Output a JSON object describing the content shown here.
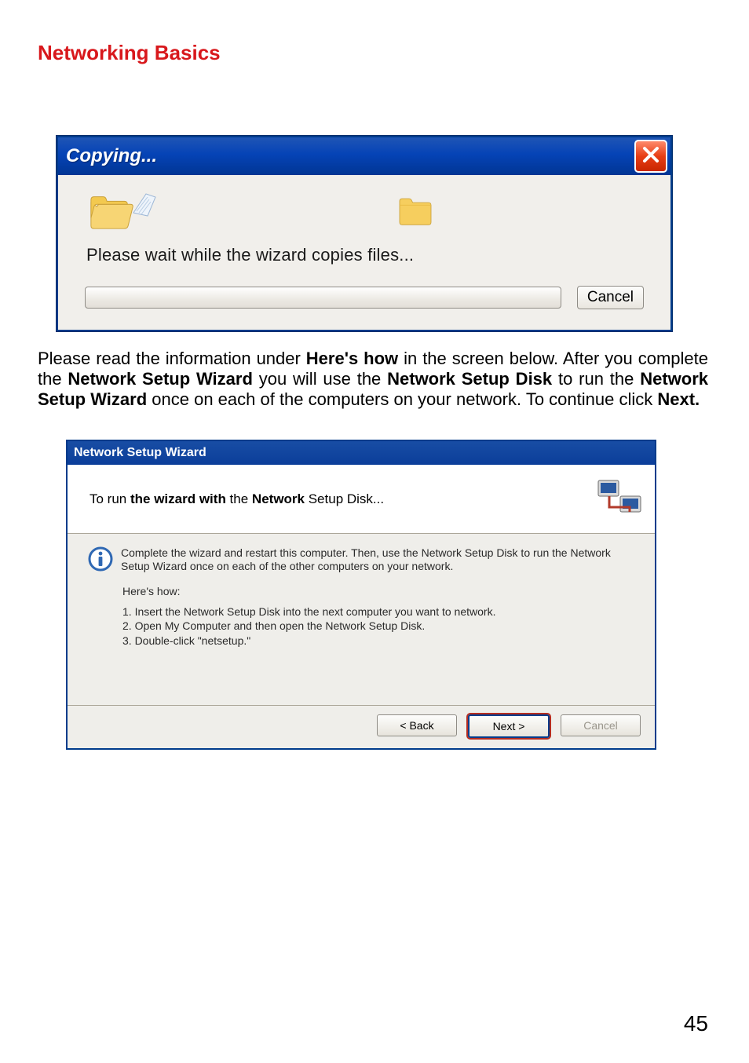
{
  "page": {
    "heading": "Networking Basics",
    "number": "45",
    "paragraph_parts": {
      "p1": "Please read the information under ",
      "b1": "Here's how",
      "p2": " in the screen below.  After you complete the ",
      "b2": "Network Setup Wizard",
      "p3": " you will use the ",
      "b3": "Network Setup Disk",
      "p4": " to run the ",
      "b4": "Network Setup Wizard",
      "p5": " once on each of the computers on your network. To continue click ",
      "b5": "Next."
    }
  },
  "copy_dialog": {
    "title": "Copying...",
    "wait_text": "Please wait while the wizard copies files...",
    "cancel_label": "Cancel"
  },
  "wizard_dialog": {
    "title": "Network Setup Wizard",
    "header_prefix": "To run ",
    "header_bold1": "the wizard with",
    "header_mid": " the ",
    "header_bold2": "Network",
    "header_suffix": " Setup Disk...",
    "info_text": "Complete the wizard and restart this computer. Then, use the Network Setup Disk to run the Network Setup Wizard once on each of the other computers on your network.",
    "heres_how": "Here's how:",
    "steps": {
      "s1": "1.  Insert the Network Setup Disk into the next computer you want to network.",
      "s2": "2.  Open My Computer and then open the Network Setup Disk.",
      "s3": "3.  Double-click \"netsetup.\""
    },
    "back_label": "< Back",
    "next_label": "Next >",
    "cancel_label": "Cancel"
  }
}
